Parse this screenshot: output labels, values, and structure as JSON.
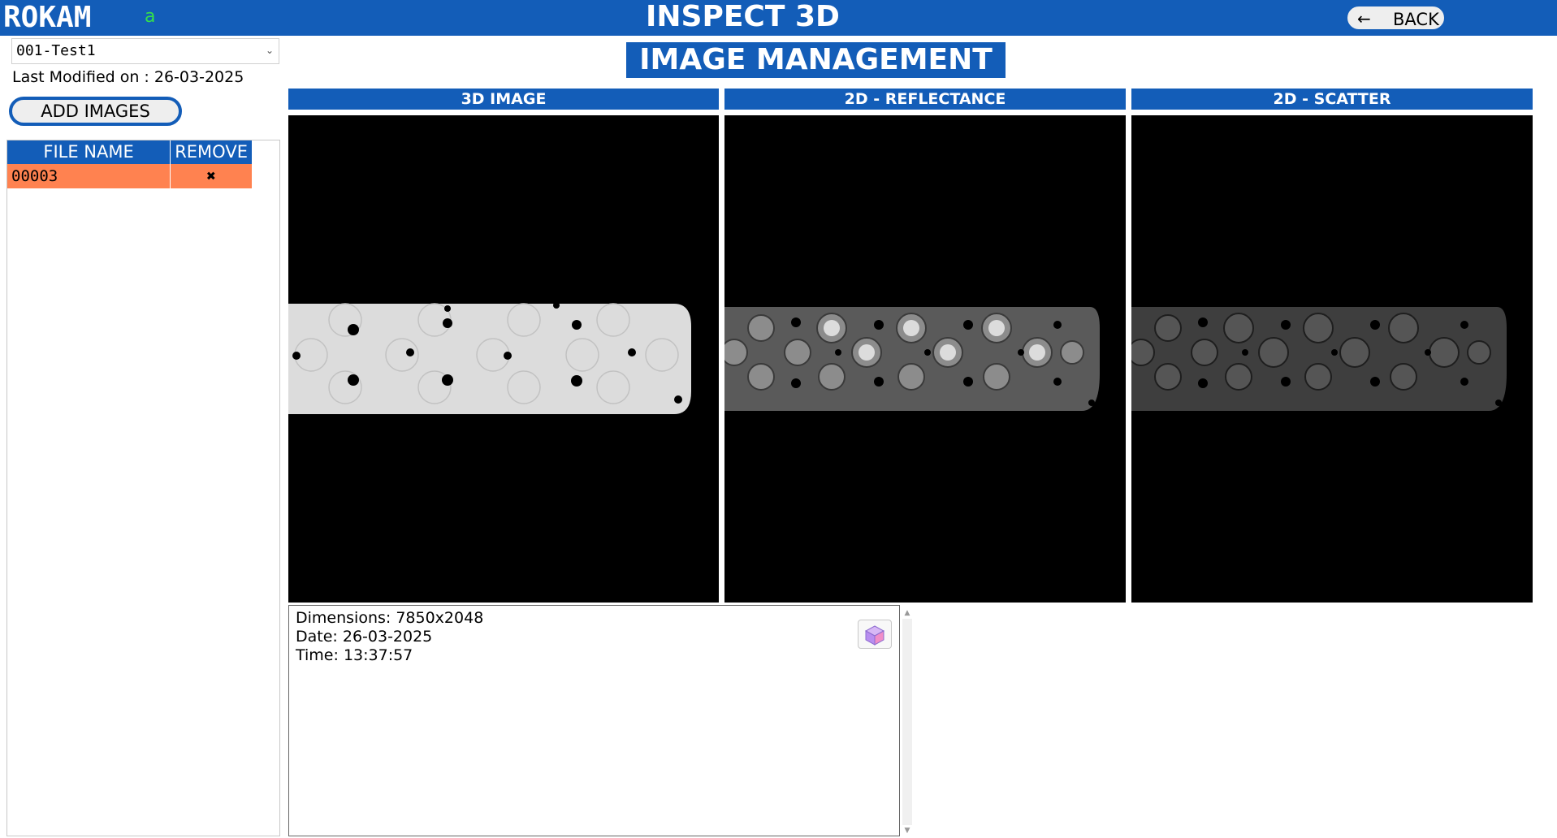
{
  "app": {
    "brand": "ROKAM",
    "user_tag": "a",
    "title": "INSPECT 3D",
    "back_label": "BACK"
  },
  "page": {
    "heading": "IMAGE MANAGEMENT"
  },
  "sidebar": {
    "project_selected": "001-Test1",
    "last_modified": "Last Modified on : 26-03-2025",
    "add_images_label": "ADD IMAGES",
    "file_table": {
      "columns": [
        "FILE NAME",
        "REMOVE"
      ],
      "rows": [
        {
          "name": "00003",
          "remove": "✖"
        }
      ]
    }
  },
  "views": [
    {
      "title": "3D IMAGE"
    },
    {
      "title": "2D - REFLECTANCE"
    },
    {
      "title": "2D - SCATTER"
    }
  ],
  "info": {
    "dimensions": "Dimensions: 7850x2048",
    "date": "Date: 26-03-2025",
    "time": "Time: 13:37:57"
  },
  "icons": {
    "back": "arrow-left-icon",
    "select": "chevron-down-icon",
    "remove": "close-icon",
    "viewer": "cube-icon"
  },
  "colors": {
    "primary": "#135db8",
    "selected_row": "#ff8250",
    "user_tag": "#35e04a"
  }
}
